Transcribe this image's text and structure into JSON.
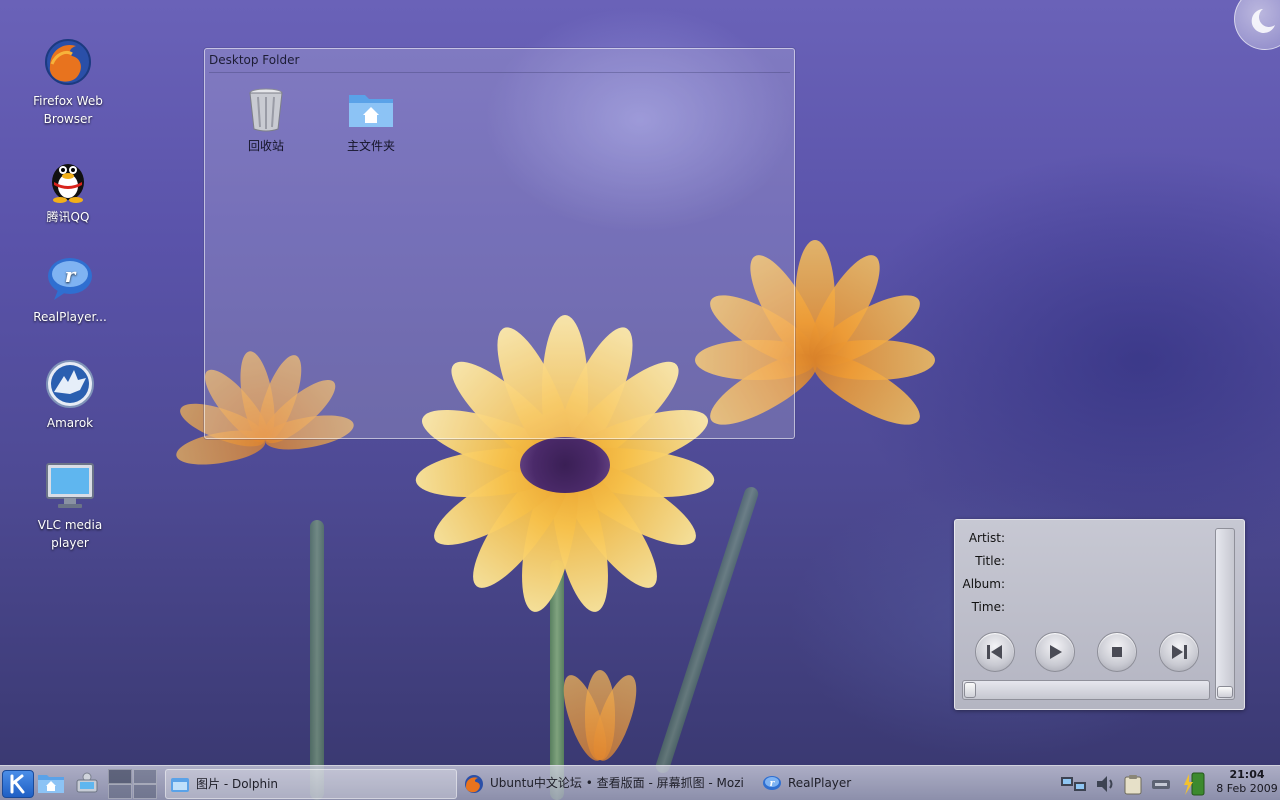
{
  "desktop_icons": [
    {
      "label_lines": [
        "Firefox Web",
        "Browser"
      ],
      "icon": "firefox-icon"
    },
    {
      "label_lines": [
        "腾讯QQ"
      ],
      "icon": "qq-penguin-icon"
    },
    {
      "label_lines": [
        "RealPlayer..."
      ],
      "icon": "realplayer-icon"
    },
    {
      "label_lines": [
        "Amarok"
      ],
      "icon": "amarok-wolf-icon"
    },
    {
      "label_lines": [
        "VLC media",
        "player"
      ],
      "icon": "monitor-icon"
    }
  ],
  "folder_view": {
    "title": "Desktop Folder",
    "items": [
      {
        "label": "回收站",
        "icon": "trash-icon"
      },
      {
        "label": "主文件夹",
        "icon": "home-folder-icon"
      }
    ]
  },
  "now_playing": {
    "labels": {
      "artist": "Artist:",
      "title": "Title:",
      "album": "Album:",
      "time": "Time:"
    },
    "controls": [
      "previous-icon",
      "play-icon",
      "stop-icon",
      "next-icon"
    ]
  },
  "taskbar": {
    "tasks": [
      {
        "label": "图片 - Dolphin",
        "icon": "dolphin-icon"
      },
      {
        "label": "Ubuntu中文论坛 • 查看版面 - 屏幕抓图 - Mozi",
        "icon": "firefox-icon"
      },
      {
        "label": "RealPlayer",
        "icon": "realplayer-icon"
      }
    ],
    "clock": {
      "time": "21:04",
      "date": "8 Feb 2009"
    }
  },
  "colors": {
    "wallpaper_top": "#6a62b8",
    "wallpaper_bottom": "#38376e",
    "petal": "#f6c04a"
  }
}
